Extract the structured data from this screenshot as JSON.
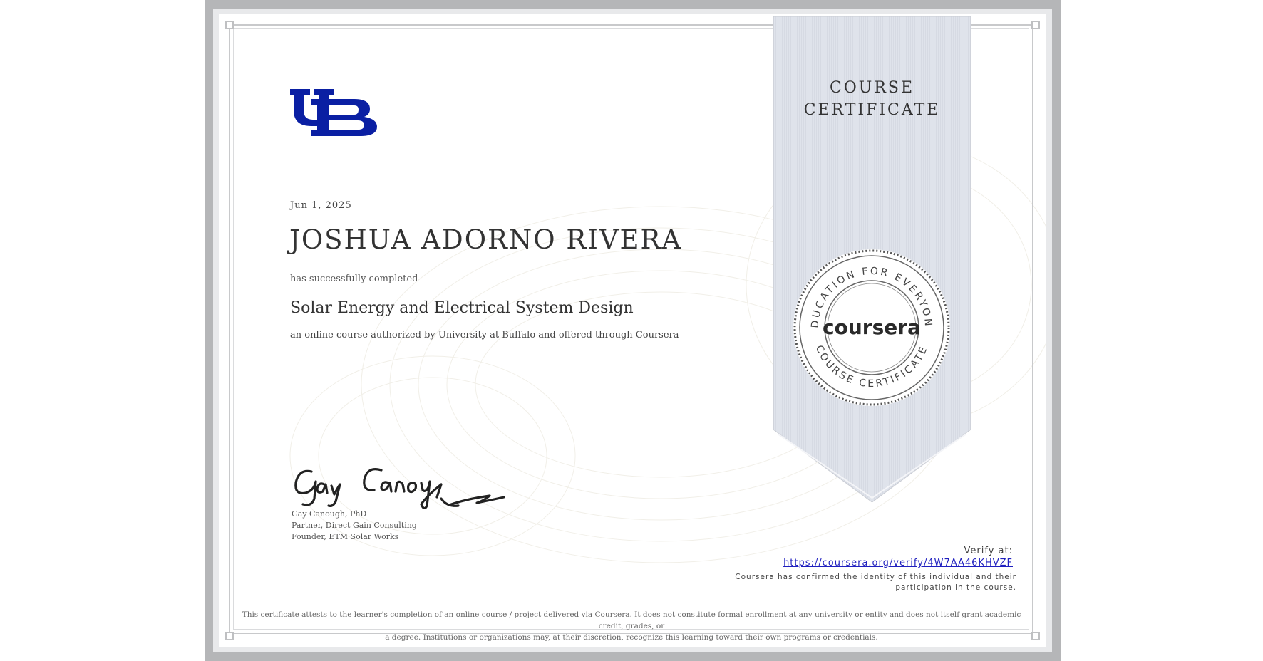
{
  "certificate": {
    "ribbon_title_line1": "COURSE",
    "ribbon_title_line2": "CERTIFICATE",
    "date": "Jun 1, 2025",
    "recipient_name": "JOSHUA ADORNO RIVERA",
    "completed_text": "has successfully completed",
    "course_name": "Solar Energy and Electrical System Design",
    "authorized_text": "an online course authorized by University at Buffalo and offered through Coursera",
    "logo_text": "UB",
    "signature_text": "Gay Canough",
    "signer": {
      "name": "Gay Canough, PhD",
      "title1": "Partner, Direct Gain Consulting",
      "title2": "Founder, ETM Solar Works"
    },
    "verify_label": "Verify at:",
    "verify_url": "https://coursera.org/verify/4W7AA46KHVZF",
    "confirm_text_line1": "Coursera has confirmed the identity of this individual and their",
    "confirm_text_line2": "participation in the course.",
    "disclaimer_line1": "This certificate attests to the learner's completion of an online course / project delivered via Coursera. It does not constitute formal enrollment at any university or entity and does not itself grant academic credit, grades, or",
    "disclaimer_line2": "a degree. Institutions or organizations may, at their discretion, recognize this learning toward their own programs or credentials."
  },
  "seal": {
    "brand": "coursera",
    "top_arc": "EDUCATION FOR EVERYONE",
    "bottom_arc": "COURSE CERTIFICATE"
  },
  "colors": {
    "logo_blue": "#0a1fa3",
    "ribbon": "#e0e4ec",
    "link": "#1f1fbf"
  }
}
